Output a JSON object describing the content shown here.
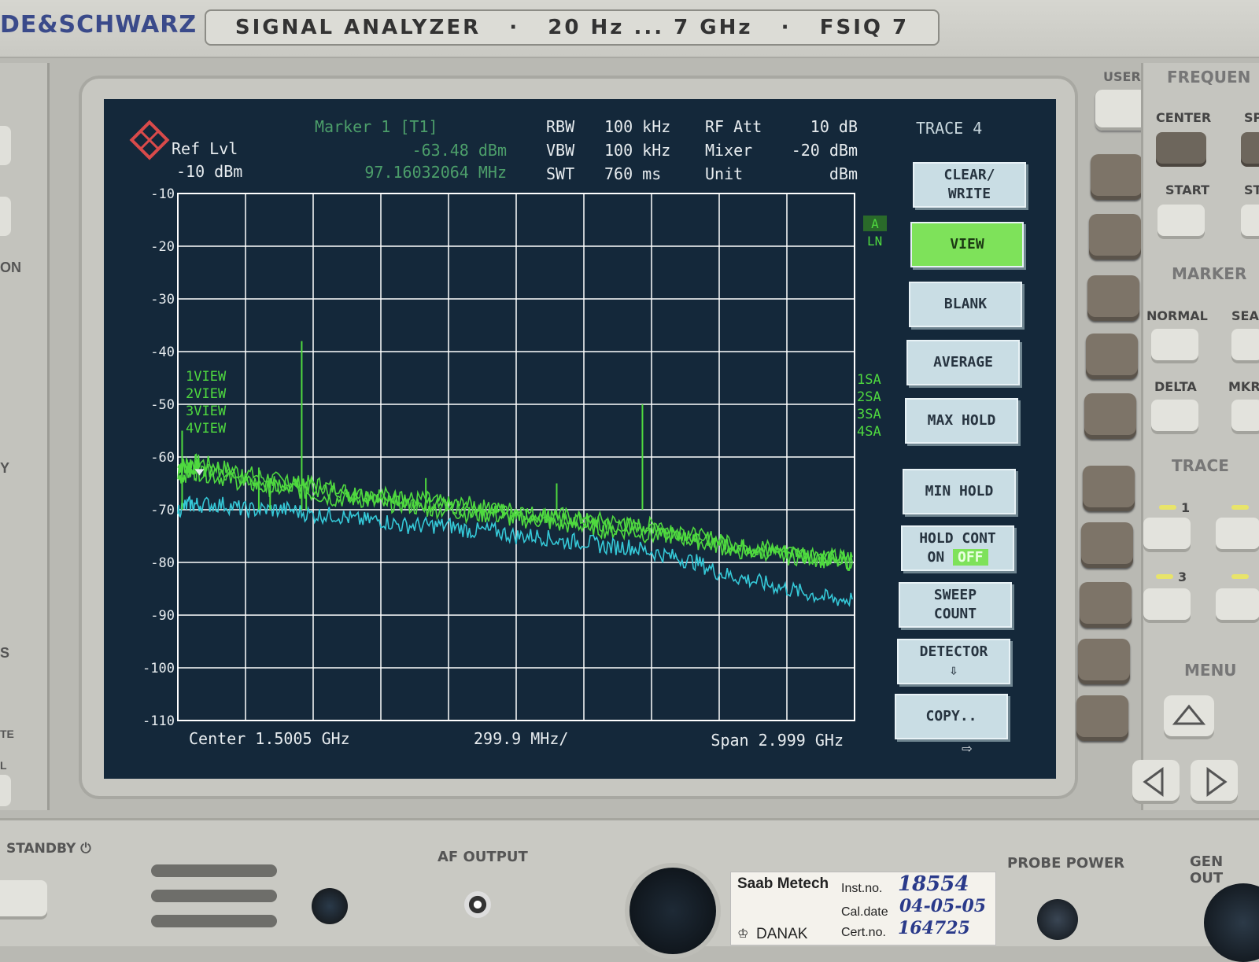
{
  "instrument": {
    "brand": "DE&SCHWARZ",
    "plate": "SIGNAL ANALYZER   ·   20 Hz ... 7 GHz   ·   FSIQ 7"
  },
  "screen": {
    "marker_title": "Marker 1 [T1]",
    "ref_label": "Ref Lvl",
    "ref_value": "-10 dBm",
    "marker_level": "-63.48 dBm",
    "marker_freq": "97.16032064 MHz",
    "rbw_label": "RBW",
    "rbw_value": "100 kHz",
    "vbw_label": "VBW",
    "vbw_value": "100 kHz",
    "swt_label": "SWT",
    "swt_value": "760 ms",
    "rfatt_label": "RF Att",
    "rfatt_value": "10 dB",
    "mixer_label": "Mixer",
    "mixer_value": "-20 dBm",
    "unit_label": "Unit",
    "unit_value": "dBm",
    "trace_title": "TRACE 4",
    "a_tag": "A",
    "ln_tag": "LN",
    "left_trace_labels": [
      "1VIEW",
      "2VIEW",
      "3VIEW",
      "4VIEW"
    ],
    "right_trace_labels": [
      "1SA",
      "2SA",
      "3SA",
      "4SA"
    ],
    "center_text": "Center 1.5005 GHz",
    "div_text": "299.9 MHz/",
    "span_text": "Span 2.999 GHz",
    "arrow_glyph": "⇨"
  },
  "softkeys": [
    {
      "line1": "CLEAR/",
      "line2": "WRITE",
      "active": false
    },
    {
      "line1": "VIEW",
      "line2": "",
      "active": true
    },
    {
      "line1": "BLANK",
      "line2": "",
      "active": false
    },
    {
      "line1": "AVERAGE",
      "line2": "",
      "active": false
    },
    {
      "line1": "MAX HOLD",
      "line2": "",
      "active": false
    },
    {
      "line1": "MIN HOLD",
      "line2": "",
      "active": false
    },
    {
      "line1": "HOLD CONT",
      "line2": "ON  OFF",
      "active": false
    },
    {
      "line1": "SWEEP",
      "line2": "COUNT",
      "active": false
    },
    {
      "line1": "DETECTOR",
      "line2": "⇩",
      "active": false
    },
    {
      "line1": "COPY..",
      "line2": "",
      "active": false
    }
  ],
  "hold_cont": {
    "top": "HOLD CONT",
    "on": "ON",
    "off": "OFF"
  },
  "detector": {
    "label": "DETECTOR",
    "arrow": "⇩"
  },
  "panel": {
    "user": "USER",
    "frequency": "FREQUEN",
    "center": "CENTER",
    "sp": "SP",
    "start": "START",
    "st": "ST",
    "marker": "MARKER",
    "normal": "NORMAL",
    "sear": "SEAR",
    "delta": "DELTA",
    "mkr": "MKR",
    "trace": "TRACE",
    "trace_1": "1",
    "trace_3": "3",
    "menu": "MENU",
    "left_on": "ON",
    "left_y": "Y",
    "left_s": "S",
    "left_te": "TE",
    "left_l": "L"
  },
  "bottom": {
    "standby": "STANDBY ⏻",
    "af_output": "AF OUTPUT",
    "probe_power": "PROBE POWER",
    "gen_out": "GEN OUT"
  },
  "sticker": {
    "company": "Saab Metech",
    "inst_label": "Inst.no.",
    "inst_value": "18554",
    "cal_label": "Cal.date",
    "cal_value": "04-05-05",
    "cert_label": "Cert.no.",
    "cert_value": "164725",
    "danak": "DANAK"
  },
  "colors": {
    "screen_bg": "#14283a",
    "grid": "#ffffff",
    "trace_green": "#4fd93f",
    "trace_cyan": "#35c9d8",
    "header_text": "#e7ecef",
    "marker_text": "#4c9e6a",
    "softkey_active": "#7ee25a"
  },
  "chart_data": {
    "type": "line",
    "title": "",
    "xlabel": "",
    "ylabel": "",
    "x_unit": "GHz",
    "xlim": [
      0.001,
      3.0
    ],
    "ylim": [
      -110,
      -10
    ],
    "y_ticks": [
      -10,
      -20,
      -30,
      -40,
      -50,
      -60,
      -70,
      -80,
      -90,
      -100,
      -110
    ],
    "grid": true,
    "series": [
      {
        "name": "1VIEW",
        "color": "#4fd93f",
        "x": [
          0.001,
          0.05,
          0.1,
          0.2,
          0.3,
          0.4,
          0.5,
          0.6,
          0.7,
          0.8,
          0.9,
          1.0,
          1.1,
          1.2,
          1.3,
          1.4,
          1.5,
          1.6,
          1.7,
          1.8,
          1.9,
          2.0,
          2.1,
          2.2,
          2.3,
          2.4,
          2.5,
          2.6,
          2.7,
          2.8,
          2.9,
          2.99
        ],
        "y": [
          -62,
          -61,
          -61,
          -62,
          -63,
          -64,
          -65,
          -65,
          -66,
          -67,
          -67,
          -68,
          -68,
          -69,
          -69,
          -70,
          -70,
          -71,
          -71,
          -72,
          -72,
          -73,
          -73,
          -74,
          -75,
          -76,
          -77,
          -77,
          -78,
          -78,
          -79,
          -79
        ]
      },
      {
        "name": "2VIEW",
        "color": "#4fd93f",
        "x": [
          0.001,
          0.05,
          0.1,
          0.2,
          0.3,
          0.4,
          0.5,
          0.6,
          0.7,
          0.8,
          0.9,
          1.0,
          1.1,
          1.2,
          1.3,
          1.4,
          1.5,
          1.6,
          1.7,
          1.8,
          1.9,
          2.0,
          2.1,
          2.2,
          2.3,
          2.4,
          2.5,
          2.6,
          2.7,
          2.8,
          2.9,
          2.99
        ],
        "y": [
          -64,
          -63,
          -63,
          -64,
          -65,
          -66,
          -66,
          -67,
          -68,
          -68,
          -69,
          -69,
          -70,
          -70,
          -71,
          -71,
          -72,
          -72,
          -73,
          -73,
          -74,
          -74,
          -75,
          -75,
          -76,
          -77,
          -78,
          -78,
          -79,
          -79,
          -80,
          -80
        ]
      },
      {
        "name": "3VIEW",
        "color": "#35c9d8",
        "x": [
          0.001,
          0.05,
          0.1,
          0.2,
          0.3,
          0.4,
          0.5,
          0.6,
          0.7,
          0.8,
          0.9,
          1.0,
          1.1,
          1.2,
          1.3,
          1.4,
          1.5,
          1.6,
          1.7,
          1.8,
          1.9,
          2.0,
          2.1,
          2.2,
          2.3,
          2.4,
          2.5,
          2.6,
          2.7,
          2.8,
          2.9,
          2.99
        ],
        "y": [
          -70,
          -69,
          -69,
          -69,
          -70,
          -70,
          -70,
          -71,
          -71,
          -72,
          -72,
          -73,
          -73,
          -73,
          -74,
          -74,
          -75,
          -75,
          -76,
          -76,
          -77,
          -77,
          -78,
          -79,
          -80,
          -82,
          -83,
          -84,
          -85,
          -86,
          -87,
          -87
        ]
      },
      {
        "name": "4VIEW",
        "color": "#4fd93f",
        "x": [
          0.001,
          0.05,
          0.1,
          0.2,
          0.3,
          0.4,
          0.5,
          0.6,
          0.7,
          0.8,
          0.9,
          1.0,
          1.1,
          1.2,
          1.3,
          1.4,
          1.5,
          1.6,
          1.7,
          1.8,
          1.9,
          2.0,
          2.1,
          2.2,
          2.3,
          2.4,
          2.5,
          2.6,
          2.7,
          2.8,
          2.9,
          2.99
        ],
        "y": [
          -63,
          -62,
          -62,
          -63,
          -64,
          -65,
          -65,
          -66,
          -67,
          -67,
          -68,
          -68,
          -69,
          -69,
          -70,
          -70,
          -71,
          -71,
          -72,
          -72,
          -73,
          -73,
          -74,
          -74,
          -75,
          -76,
          -77,
          -78,
          -78,
          -79,
          -79,
          -80
        ]
      }
    ],
    "spikes": [
      {
        "x": 0.55,
        "y": -38,
        "color": "#4fd93f"
      },
      {
        "x": 0.57,
        "y": -66,
        "color": "#4fd93f"
      },
      {
        "x": 0.36,
        "y": -62,
        "color": "#4fd93f"
      },
      {
        "x": 0.41,
        "y": -64,
        "color": "#4fd93f"
      },
      {
        "x": 1.1,
        "y": -64,
        "color": "#4fd93f"
      },
      {
        "x": 1.68,
        "y": -65,
        "color": "#4fd93f"
      },
      {
        "x": 2.06,
        "y": -50,
        "color": "#4fd93f"
      },
      {
        "x": 0.02,
        "y": -55,
        "color": "#4fd93f"
      }
    ],
    "marker": {
      "x": 0.097,
      "y": -63.48
    }
  }
}
